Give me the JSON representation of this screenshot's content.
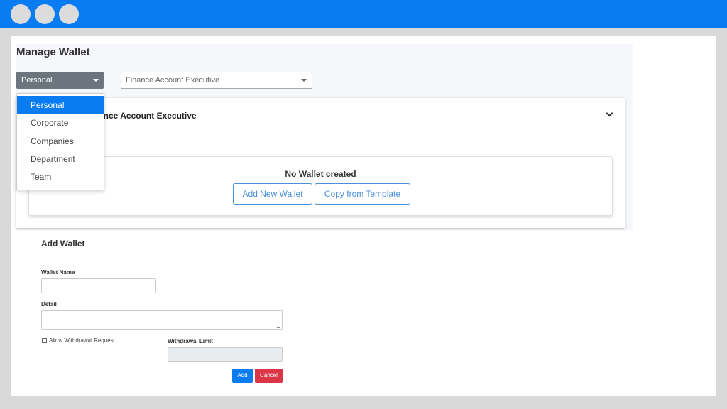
{
  "page": {
    "title": "Manage Wallet"
  },
  "filters": {
    "type_select": "Personal",
    "role_select": "Finance Account Executive"
  },
  "account_card": {
    "heading": "Finance Account Executive"
  },
  "wallet_box": {
    "empty_text": "No Wallet created",
    "add_label": "Add New Wallet",
    "template_label": "Copy from Template"
  },
  "dropdown": {
    "items": [
      "Personal",
      "Corporate",
      "Companies",
      "Department",
      "Team"
    ],
    "selected_index": 0
  },
  "add_wallet": {
    "title": "Add Wallet",
    "wallet_name_label": "Wallet Name",
    "detail_label": "Detail",
    "allow_withdrawal_label": "Allow Withdrawal Request",
    "withdrawal_limit_label": "Withdrawal Limit",
    "add_label": "Add",
    "cancel_label": "Cancel"
  },
  "colors": {
    "titlebar": "#0a7cf2",
    "primary": "#0a7cf2",
    "danger": "#dc3545",
    "secondary": "#6c757d"
  }
}
